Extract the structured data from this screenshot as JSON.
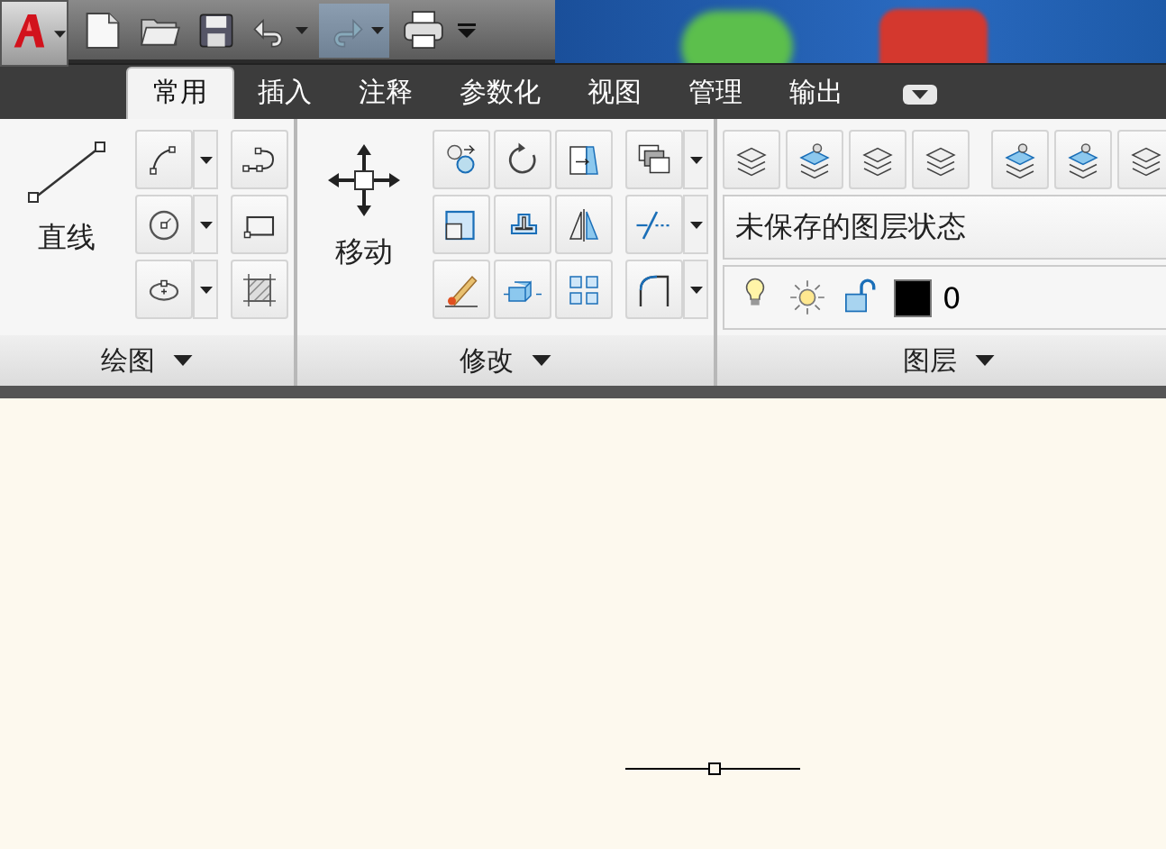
{
  "tabs": [
    {
      "label": "常用",
      "selected": true
    },
    {
      "label": "插入",
      "selected": false
    },
    {
      "label": "注释",
      "selected": false
    },
    {
      "label": "参数化",
      "selected": false
    },
    {
      "label": "视图",
      "selected": false
    },
    {
      "label": "管理",
      "selected": false
    },
    {
      "label": "输出",
      "selected": false
    }
  ],
  "panels": [
    {
      "kind": "draw",
      "title": "绘图",
      "large_button": "直线"
    },
    {
      "kind": "modify",
      "title": "修改",
      "large_button": "移动"
    },
    {
      "kind": "layers",
      "title": "图层",
      "layer_state": "未保存的图层状态",
      "current_layer": "0"
    }
  ]
}
